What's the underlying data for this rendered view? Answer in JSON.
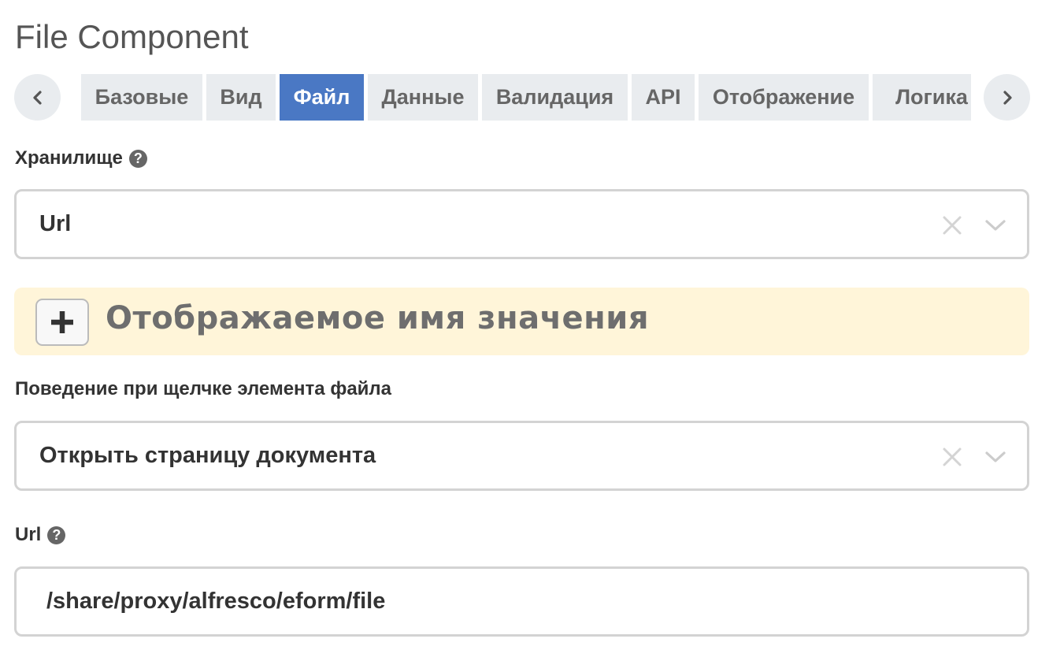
{
  "header": {
    "title": "File Component"
  },
  "tabs": [
    {
      "label": "Базовые",
      "active": false
    },
    {
      "label": "Вид",
      "active": false
    },
    {
      "label": "Файл",
      "active": true
    },
    {
      "label": "Данные",
      "active": false
    },
    {
      "label": "Валидация",
      "active": false
    },
    {
      "label": "API",
      "active": false
    },
    {
      "label": "Отображение",
      "active": false
    },
    {
      "label": "Логика",
      "active": false
    }
  ],
  "nav": {
    "prev_icon": "chevron-left-icon",
    "next_icon": "chevron-right-icon"
  },
  "storage": {
    "label": "Хранилище",
    "value": "Url",
    "help_icon": "question-circle-icon"
  },
  "display_name_panel": {
    "title": "Отображаемое имя значения",
    "add_icon": "plus-icon"
  },
  "click_behavior": {
    "label": "Поведение при щелчке элемента файла",
    "value": "Открыть страницу документа"
  },
  "url": {
    "label": "Url",
    "value": "/share/proxy/alfresco/eform/file",
    "help_icon": "question-circle-icon"
  },
  "colors": {
    "active_tab": "#4a78c4",
    "tab_bg": "#e9ecef",
    "panel_bg": "#fff5d9",
    "border": "#d3d3d3"
  }
}
